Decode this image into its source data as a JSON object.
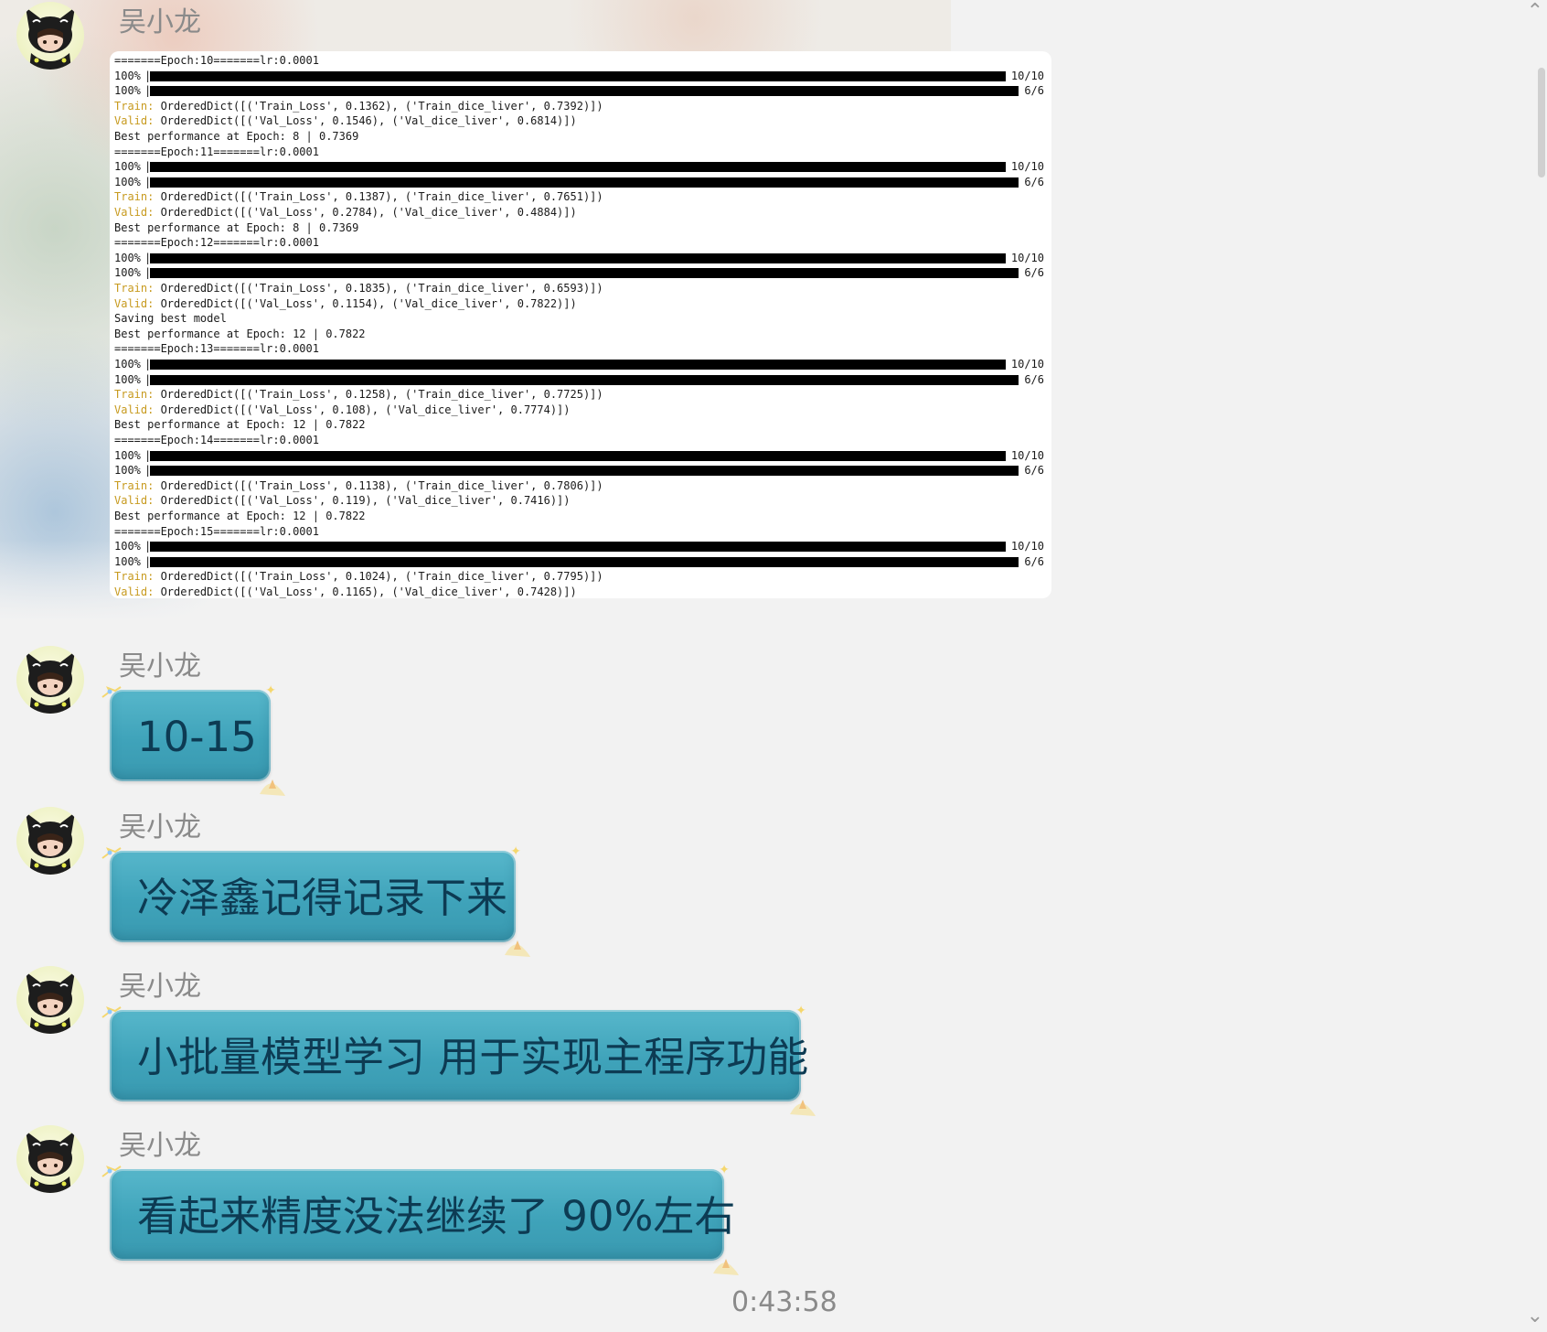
{
  "sender_name": "吴小龙",
  "log": {
    "entries": [
      {
        "kind": "text",
        "text": "=======Epoch:10=======lr:0.0001"
      },
      {
        "kind": "progress",
        "percent": "100%",
        "fraction": 1.0,
        "count": "10/10"
      },
      {
        "kind": "progress",
        "percent": "100%",
        "fraction": 1.0,
        "count": "6/6"
      },
      {
        "kind": "prefixed",
        "prefix": "Train:",
        "text": " OrderedDict([('Train_Loss', 0.1362), ('Train_dice_liver', 0.7392)])"
      },
      {
        "kind": "prefixed",
        "prefix": "Valid:",
        "text": " OrderedDict([('Val_Loss', 0.1546), ('Val_dice_liver', 0.6814)])"
      },
      {
        "kind": "text",
        "text": "Best performance at Epoch: 8 | 0.7369"
      },
      {
        "kind": "text",
        "text": "=======Epoch:11=======lr:0.0001"
      },
      {
        "kind": "progress",
        "percent": "100%",
        "fraction": 1.0,
        "count": "10/10"
      },
      {
        "kind": "progress",
        "percent": "100%",
        "fraction": 1.0,
        "count": "6/6"
      },
      {
        "kind": "prefixed",
        "prefix": "Train:",
        "text": " OrderedDict([('Train_Loss', 0.1387), ('Train_dice_liver', 0.7651)])"
      },
      {
        "kind": "prefixed",
        "prefix": "Valid:",
        "text": " OrderedDict([('Val_Loss', 0.2784), ('Val_dice_liver', 0.4884)])"
      },
      {
        "kind": "text",
        "text": "Best performance at Epoch: 8 | 0.7369"
      },
      {
        "kind": "text",
        "text": "=======Epoch:12=======lr:0.0001"
      },
      {
        "kind": "progress",
        "percent": "100%",
        "fraction": 1.0,
        "count": "10/10"
      },
      {
        "kind": "progress",
        "percent": "100%",
        "fraction": 1.0,
        "count": "6/6"
      },
      {
        "kind": "prefixed",
        "prefix": "Train:",
        "text": " OrderedDict([('Train_Loss', 0.1835), ('Train_dice_liver', 0.6593)])"
      },
      {
        "kind": "prefixed",
        "prefix": "Valid:",
        "text": " OrderedDict([('Val_Loss', 0.1154), ('Val_dice_liver', 0.7822)])"
      },
      {
        "kind": "text",
        "text": "Saving best model"
      },
      {
        "kind": "text",
        "text": "Best performance at Epoch: 12 | 0.7822"
      },
      {
        "kind": "text",
        "text": "=======Epoch:13=======lr:0.0001"
      },
      {
        "kind": "progress",
        "percent": "100%",
        "fraction": 1.0,
        "count": "10/10"
      },
      {
        "kind": "progress",
        "percent": "100%",
        "fraction": 1.0,
        "count": "6/6"
      },
      {
        "kind": "prefixed",
        "prefix": "Train:",
        "text": " OrderedDict([('Train_Loss', 0.1258), ('Train_dice_liver', 0.7725)])"
      },
      {
        "kind": "prefixed",
        "prefix": "Valid:",
        "text": " OrderedDict([('Val_Loss', 0.108), ('Val_dice_liver', 0.7774)])"
      },
      {
        "kind": "text",
        "text": "Best performance at Epoch: 12 | 0.7822"
      },
      {
        "kind": "text",
        "text": "=======Epoch:14=======lr:0.0001"
      },
      {
        "kind": "progress",
        "percent": "100%",
        "fraction": 1.0,
        "count": "10/10"
      },
      {
        "kind": "progress",
        "percent": "100%",
        "fraction": 1.0,
        "count": "6/6"
      },
      {
        "kind": "prefixed",
        "prefix": "Train:",
        "text": " OrderedDict([('Train_Loss', 0.1138), ('Train_dice_liver', 0.7806)])"
      },
      {
        "kind": "prefixed",
        "prefix": "Valid:",
        "text": " OrderedDict([('Val_Loss', 0.119), ('Val_dice_liver', 0.7416)])"
      },
      {
        "kind": "text",
        "text": "Best performance at Epoch: 12 | 0.7822"
      },
      {
        "kind": "text",
        "text": "=======Epoch:15=======lr:0.0001"
      },
      {
        "kind": "progress",
        "percent": "100%",
        "fraction": 1.0,
        "count": "10/10"
      },
      {
        "kind": "progress",
        "percent": "100%",
        "fraction": 1.0,
        "count": "6/6"
      },
      {
        "kind": "prefixed",
        "prefix": "Train:",
        "text": " OrderedDict([('Train_Loss', 0.1024), ('Train_dice_liver', 0.7795)])"
      },
      {
        "kind": "prefixed",
        "prefix": "Valid:",
        "text": " OrderedDict([('Val_Loss', 0.1165), ('Val_dice_liver', 0.7428)])"
      }
    ]
  },
  "messages": [
    {
      "sender": "吴小龙",
      "text": "10-15"
    },
    {
      "sender": "吴小龙",
      "text": "冷泽鑫记得记录下来"
    },
    {
      "sender": "吴小龙",
      "text": "小批量模型学习 用于实现主程序功能"
    },
    {
      "sender": "吴小龙",
      "text": "看起来精度没法继续了 90%左右"
    }
  ],
  "timestamp": "0:43:58",
  "colors": {
    "bubble": "#3fa3ba",
    "bubble_text": "#0d3b53",
    "log_prefix": "#c79a1e",
    "sender": "#8a8a8a",
    "background": "#f2f2f2"
  },
  "icons": {
    "avatar": "cat-hood-avatar-icon",
    "scroll_top": "chevron-up-icon",
    "scroll_bottom": "chevron-down-icon"
  }
}
